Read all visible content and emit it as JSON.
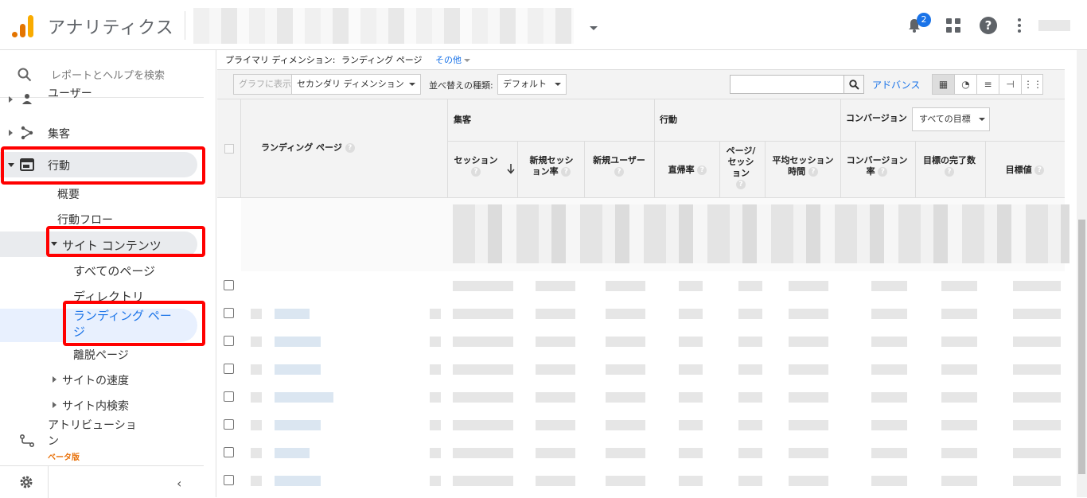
{
  "header": {
    "app_title": "アナリティクス",
    "notifications_count": "2"
  },
  "sidebar": {
    "search_placeholder": "レポートとヘルプを検索",
    "items": [
      {
        "label": "ユーザー"
      },
      {
        "label": "集客"
      },
      {
        "label": "行動"
      },
      {
        "label": "概要"
      },
      {
        "label": "行動フロー"
      },
      {
        "label": "サイト コンテンツ"
      },
      {
        "label": "すべてのページ"
      },
      {
        "label": "ディレクトリ"
      },
      {
        "label": "ランディング ペー\nジ"
      },
      {
        "label": "離脱ページ"
      },
      {
        "label": "サイトの速度"
      },
      {
        "label": "サイト内検索"
      },
      {
        "label": "アトリビューショ\nン"
      }
    ],
    "beta_label": "ベータ版"
  },
  "dimension_bar": {
    "label": "プライマリ ディメンション:",
    "value": "ランディング ページ",
    "other": "その他"
  },
  "toolbar": {
    "chart_button": "グラフに表示",
    "secondary_dimension": "セカンダリ ディメンション",
    "sort_label": "並べ替えの種類:",
    "sort_value": "デフォルト",
    "advance": "アドバンス"
  },
  "table": {
    "dimension_header": "ランディング ページ",
    "groups": {
      "acquisition": "集客",
      "behavior": "行動",
      "conversion": "コンバージョン"
    },
    "goal_select": "すべての目標",
    "columns": {
      "sessions": "セッション",
      "new_session_rate": "新規セッション率",
      "new_users": "新規ユーザー",
      "bounce_rate": "直帰率",
      "pages_per_session": "ページ/セッション",
      "avg_session_duration": "平均セッション時間",
      "conversion_rate": "コンバージョン率",
      "goal_completions": "目標の完了数",
      "goal_value": "目標値"
    }
  },
  "colors": {
    "accent": "#1a73e8",
    "highlight": "#ff0000",
    "logo_orange": "#e37400",
    "logo_yellow": "#f9ab00"
  }
}
